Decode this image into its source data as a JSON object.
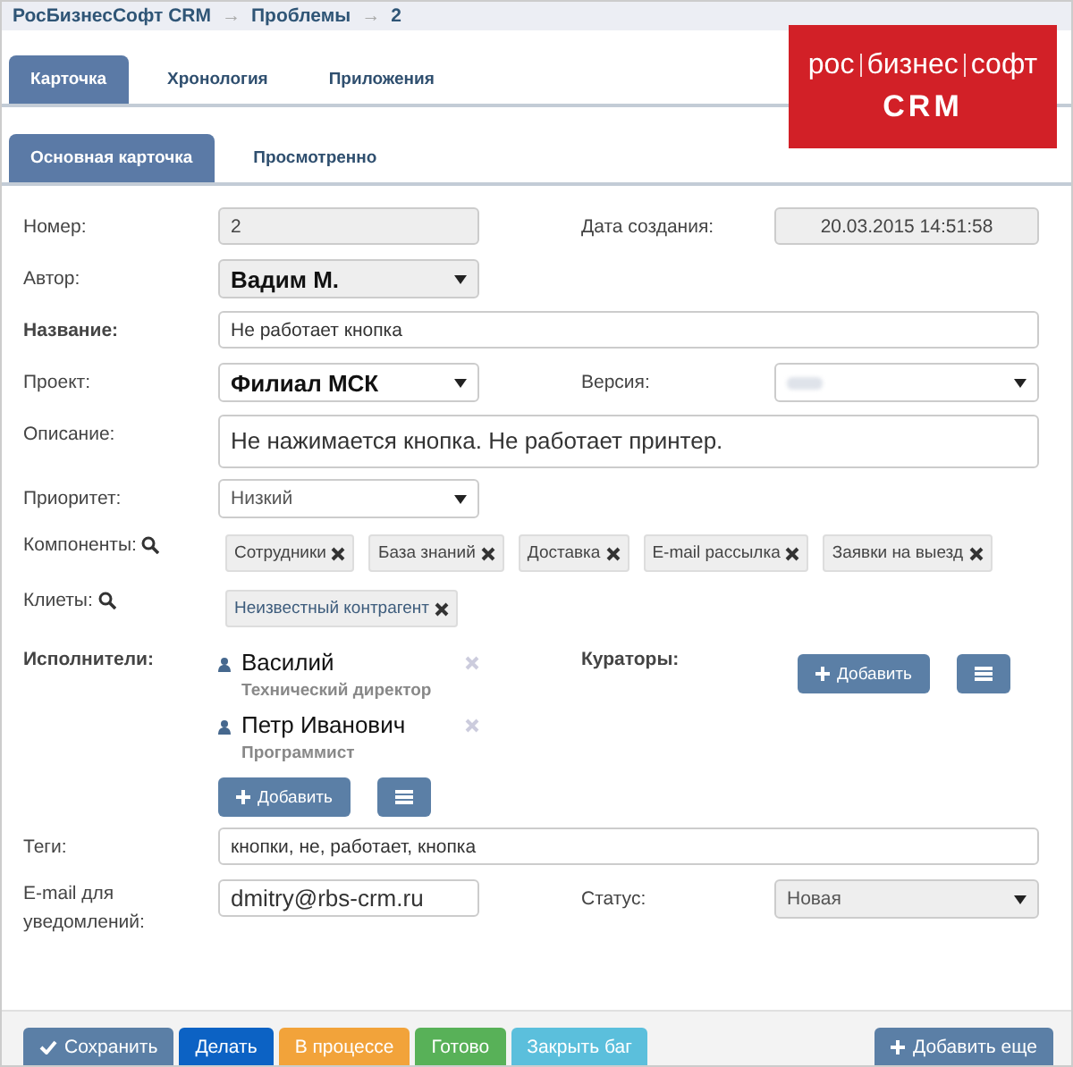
{
  "breadcrumb": [
    "РосБизнесСофт CRM",
    "Проблемы",
    "2"
  ],
  "breadcrumb_separator": "→",
  "logo": {
    "line1": [
      "рос",
      "бизнес",
      "софт"
    ],
    "line2": "CRM"
  },
  "tabs": [
    {
      "label": "Карточка",
      "selected": true
    },
    {
      "label": "Хронология",
      "selected": false
    },
    {
      "label": "Приложения",
      "selected": false
    }
  ],
  "subtabs": [
    {
      "label": "Основная карточка",
      "selected": true
    },
    {
      "label": "Просмотренно",
      "selected": false
    }
  ],
  "fields": {
    "number": {
      "label": "Номер:",
      "value": "2"
    },
    "created": {
      "label": "Дата создания:",
      "value": "20.03.2015 14:51:58"
    },
    "author": {
      "label": "Автор:",
      "value": "Вадим М."
    },
    "title": {
      "label": "Название:",
      "value": "Не работает кнопка"
    },
    "project": {
      "label": "Проект:",
      "value": "Филиал МСК"
    },
    "version": {
      "label": "Версия:"
    },
    "description": {
      "label": "Описание:",
      "value": "Не нажимается кнопка. Не работает принтер."
    },
    "priority": {
      "label": "Приоритет:",
      "value": "Низкий"
    }
  },
  "components": {
    "label": "Компоненты:",
    "tags": [
      "Сотрудники",
      "База знаний",
      "Доставка",
      "E-mail рассылка",
      "Заявки на выезд"
    ]
  },
  "clients": {
    "label": "Клиеты:",
    "tags": [
      "Неизвестный контрагент"
    ]
  },
  "executors": {
    "label": "Исполнители:",
    "people": [
      {
        "name": "Василий",
        "role": "Технический директор"
      },
      {
        "name": "Петр Иванович",
        "role": "Программист"
      }
    ],
    "add_button": "Добавить"
  },
  "curators": {
    "label": "Кураторы:",
    "add_button": "Добавить"
  },
  "tags_field": {
    "label": "Теги:",
    "value": "кнопки, не, работает, кнопка"
  },
  "email": {
    "label": "E-mail для уведомлений:",
    "value": "dmitry@rbs-crm.ru"
  },
  "status": {
    "label": "Статус:",
    "value": "Новая"
  },
  "actions": [
    {
      "label": "Сохранить",
      "kind": "save",
      "color": "#5b7fa6"
    },
    {
      "label": "Делать",
      "kind": "plain",
      "color": "#0c62c4"
    },
    {
      "label": "В процессе",
      "kind": "plain",
      "color": "#f2a33a"
    },
    {
      "label": "Готово",
      "kind": "plain",
      "color": "#58b158"
    },
    {
      "label": "Закрыть баг",
      "kind": "plain",
      "color": "#5bbfdc"
    }
  ],
  "add_more": {
    "label": "Добавить еще",
    "kind": "add",
    "color": "#5b7fa6"
  }
}
